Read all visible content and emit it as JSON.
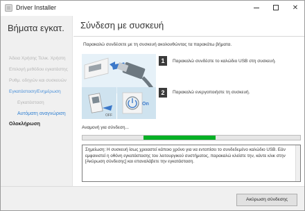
{
  "window": {
    "title": "Driver Installer",
    "icon": "installer-icon"
  },
  "sidebar": {
    "heading": "Βήματα εγκατ.",
    "items": [
      {
        "label": "Άδεια Χρήσης Τελικ. Χρήστη",
        "state": "done"
      },
      {
        "label": "Επιλογή μεθόδου εγκατάστης",
        "state": "done"
      },
      {
        "label": "Ρυθμ. οδηγών και συσκευών",
        "state": "done"
      },
      {
        "label": "Εγκατάσταση/Ενημέρωση",
        "state": "active-parent"
      },
      {
        "label": "Εγκατάσταση",
        "state": "done"
      },
      {
        "label": "Αυτόματη αναγνώριση",
        "state": "current"
      },
      {
        "label": "Ολοκλήρωση",
        "state": "pending"
      }
    ]
  },
  "main": {
    "title": "Σύνδεση με συσκευή",
    "instruction": "Παρακαλώ συνδέσετε με τη συσκευή ακολουθώντας τα παρακάτω βήματα.",
    "steps": [
      {
        "number": "1",
        "text": "Παρακαλώ συνδέστε το καλώδιο USB στη συσκευή."
      },
      {
        "number": "2",
        "text": "Παρακαλώ ενεργοποιήστε τη συσκευή."
      }
    ],
    "illustration": {
      "usb_arrow_color": "#3b78c9",
      "off_label": "OFF",
      "on_label": "On"
    },
    "wait_text": "Αναμονή για σύνδεση...",
    "progress": {
      "start": 0.28,
      "end": 0.61,
      "color": "#06b025"
    },
    "note": "Σημείωση: Η συσκευή ίσως χρειαστεί κάποιο χρόνο για να εντοπίσει το συνδεδεμένο καλώδιο USB. Εάν εμφανιστεί η οθόνη εγκατάστασης του λειτουργικού συστήματος, παρακαλώ κλείστε την, κάντε κλικ στην [Ακύρωση σύνδεσης] και επαναλάβετε την εγκατάσταση."
  },
  "footer": {
    "cancel_label": "Ακύρωση σύνδεσης"
  }
}
